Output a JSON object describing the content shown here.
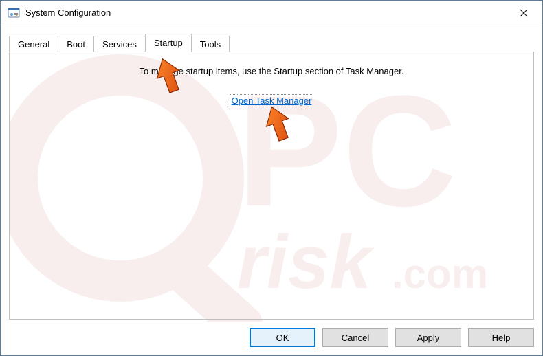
{
  "window": {
    "title": "System Configuration"
  },
  "tabs": {
    "general": "General",
    "boot": "Boot",
    "services": "Services",
    "startup": "Startup",
    "tools": "Tools"
  },
  "startup_tab": {
    "instruction": "To manage startup items, use the Startup section of Task Manager.",
    "open_link": "Open Task Manager"
  },
  "buttons": {
    "ok": "OK",
    "cancel": "Cancel",
    "apply": "Apply",
    "help": "Help"
  },
  "watermark": {
    "text_top": "PC",
    "text_bottom": "risk.com"
  }
}
